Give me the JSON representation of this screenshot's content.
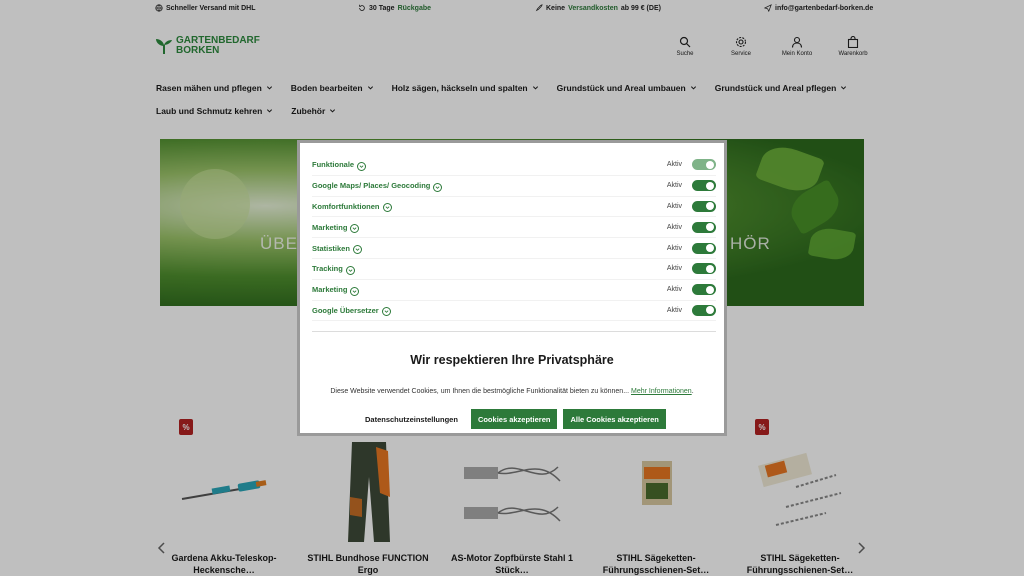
{
  "topbar": {
    "shipping": {
      "text": "Schneller Versand mit DHL"
    },
    "returns": {
      "prefix": "30 Tage ",
      "highlight": "Rückgabe"
    },
    "free_shipping": {
      "prefix": "Keine ",
      "highlight": "Versandkosten",
      "suffix": " ab 99 € (DE)"
    },
    "email": "info@gartenbedarf-borken.de"
  },
  "logo": {
    "line1": "GARTENBEDARF",
    "line2": "BORKEN"
  },
  "header_actions": [
    {
      "label": "Suche",
      "icon": "search-icon"
    },
    {
      "label": "Service",
      "icon": "gear-icon"
    },
    {
      "label": "Mein Konto",
      "icon": "user-icon"
    },
    {
      "label": "Warenkorb",
      "icon": "bag-icon"
    }
  ],
  "nav": {
    "row1": [
      "Rasen mähen und pflegen",
      "Boden bearbeiten",
      "Holz sägen, häckseln und spalten",
      "Grundstück und Areal umbauen",
      "Grundstück und Areal pflegen"
    ],
    "row2": [
      "Laub und Schmutz kehren",
      "Zubehör"
    ]
  },
  "hero": {
    "title_left": "ÜBE",
    "title_right": "HÖR"
  },
  "products": [
    {
      "title": "Gardena Akku-Teleskop-Heckensche…",
      "badge": "%"
    },
    {
      "title": "STIHL Bundhose FUNCTION Ergo",
      "badge": "%"
    },
    {
      "title": "AS-Motor Zopfbürste Stahl 1 Stück…",
      "badge": "%"
    },
    {
      "title": "STIHL Sägeketten-Führungsschienen-Set…",
      "badge": "%"
    },
    {
      "title": "STIHL Sägeketten-Führungsschienen-Set…",
      "badge": "%"
    }
  ],
  "cookie_modal": {
    "categories": [
      {
        "name": "Funktionale",
        "status": "Aktiv",
        "disabled": true
      },
      {
        "name": "Google Maps/ Places/ Geocoding",
        "status": "Aktiv",
        "disabled": false
      },
      {
        "name": "Komfortfunktionen",
        "status": "Aktiv",
        "disabled": false
      },
      {
        "name": "Marketing",
        "status": "Aktiv",
        "disabled": false
      },
      {
        "name": "Statistiken",
        "status": "Aktiv",
        "disabled": false
      },
      {
        "name": "Tracking",
        "status": "Aktiv",
        "disabled": false
      },
      {
        "name": "Marketing",
        "status": "Aktiv",
        "disabled": false
      },
      {
        "name": "Google Übersetzer",
        "status": "Aktiv",
        "disabled": false
      }
    ],
    "title": "Wir respektieren Ihre Privatsphäre",
    "text": "Diese Website verwendet Cookies, um Ihnen die bestmögliche Funktionalität bieten zu können...",
    "more_link": "Mehr Informationen",
    "buttons": {
      "settings": "Datenschutzeinstellungen",
      "accept": "Cookies akzeptieren",
      "accept_all": "Alle Cookies akzeptieren"
    }
  },
  "colors": {
    "brand_green": "#2d7a3a",
    "badge_red": "#b32222"
  }
}
